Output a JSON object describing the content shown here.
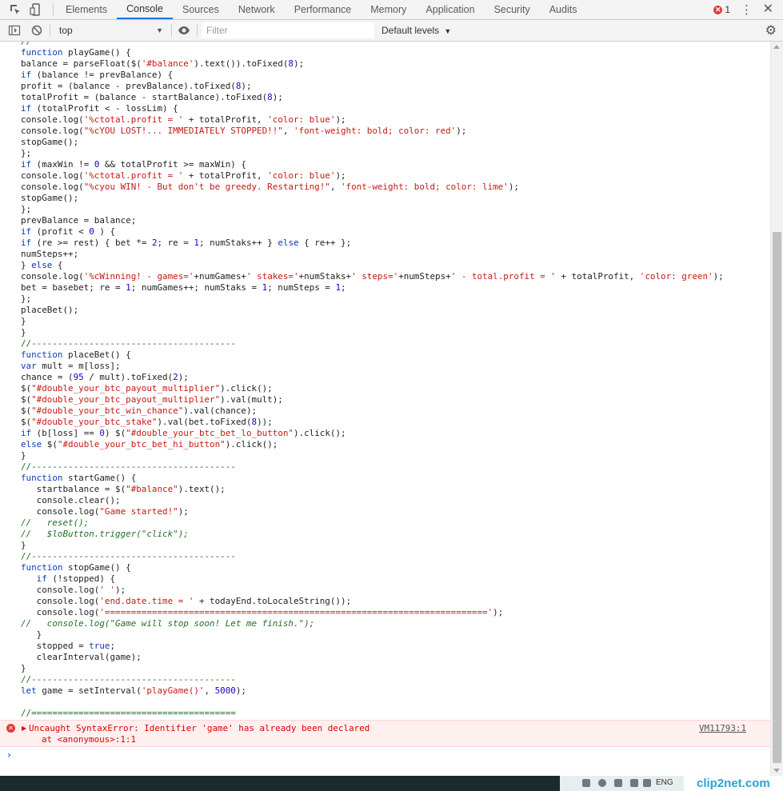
{
  "tabs": [
    "Elements",
    "Console",
    "Sources",
    "Network",
    "Performance",
    "Memory",
    "Application",
    "Security",
    "Audits"
  ],
  "active_tab": "Console",
  "error_count": "1",
  "toolbar": {
    "context": "top",
    "filter_placeholder": "Filter",
    "levels": "Default levels"
  },
  "code_lines": [
    "//",
    "function playGame() {",
    "balance = parseFloat($('#balance').text()).toFixed(8);",
    "if (balance != prevBalance) {",
    "profit = (balance - prevBalance).toFixed(8);",
    "totalProfit = (balance - startBalance).toFixed(8);",
    "if (totalProfit < - lossLim) {",
    "console.log('%ctotal.profit = ' + totalProfit, 'color: blue');",
    "console.log(\"%cYOU LOST!... IMMEDIATELY STOPPED!!\", 'font-weight: bold; color: red');",
    "stopGame();",
    "};",
    "if (maxWin != 0 && totalProfit >= maxWin) {",
    "console.log('%ctotal.profit = ' + totalProfit, 'color: blue');",
    "console.log(\"%cyou WIN! - But don't be greedy. Restarting!\", 'font-weight: bold; color: lime');",
    "stopGame();",
    "};",
    "prevBalance = balance;",
    "if (profit < 0 ) {",
    "if (re >= rest) { bet *= 2; re = 1; numStaks++ } else { re++ };",
    "numSteps++;",
    "} else {",
    "console.log('%cWinning! - games='+numGames+' stakes='+numStaks+' steps='+numSteps+' - total.profit = ' + totalProfit, 'color: green');",
    "bet = basebet; re = 1; numGames++; numStaks = 1; numSteps = 1;",
    "};",
    "placeBet();",
    "}",
    "}",
    "//---------------------------------------",
    "function placeBet() {",
    "var mult = m[loss];",
    "chance = (95 / mult).toFixed(2);",
    "$(\"#double_your_btc_payout_multiplier\").click();",
    "$(\"#double_your_btc_payout_multiplier\").val(mult);",
    "$(\"#double_your_btc_win_chance\").val(chance);",
    "$(\"#double_your_btc_stake\").val(bet.toFixed(8));",
    "if (b[loss] == 0) $(\"#double_your_btc_bet_lo_button\").click();",
    "else $(\"#double_your_btc_bet_hi_button\").click();",
    "}",
    "//---------------------------------------",
    "function startGame() {",
    "   startbalance = $(\"#balance\").text();",
    "   console.clear();",
    "   console.log(\"Game started!\");",
    "//   reset();",
    "//   $loButton.trigger(\"click\");",
    "}",
    "//---------------------------------------",
    "function stopGame() {",
    "   if (!stopped) {",
    "   console.log(' ');",
    "   console.log('end.date.time = ' + todayEnd.toLocaleString());",
    "   console.log('=========================================================================');",
    "//   console.log(\"Game will stop soon! Let me finish.\");",
    "   }",
    "   stopped = true;",
    "   clearInterval(game);",
    "}",
    "//---------------------------------------",
    "let game = setInterval('playGame()', 5000);",
    "",
    "//======================================="
  ],
  "error": {
    "message": "Uncaught SyntaxError: Identifier 'game' has already been declared",
    "trace": "at <anonymous>:1:1",
    "source": "VM11793:1"
  },
  "prompt_symbol": "›",
  "taskbar": {
    "language": "ENG"
  },
  "watermark": "clip2net.com",
  "colors": {
    "keyword": "#0c3ab2",
    "string": "#c41a16",
    "comment": "#236e25",
    "number": "#1c00cf",
    "error_bg": "#fff0f0",
    "error_text": "#dd0000",
    "tab_active": "#1a73e8"
  }
}
